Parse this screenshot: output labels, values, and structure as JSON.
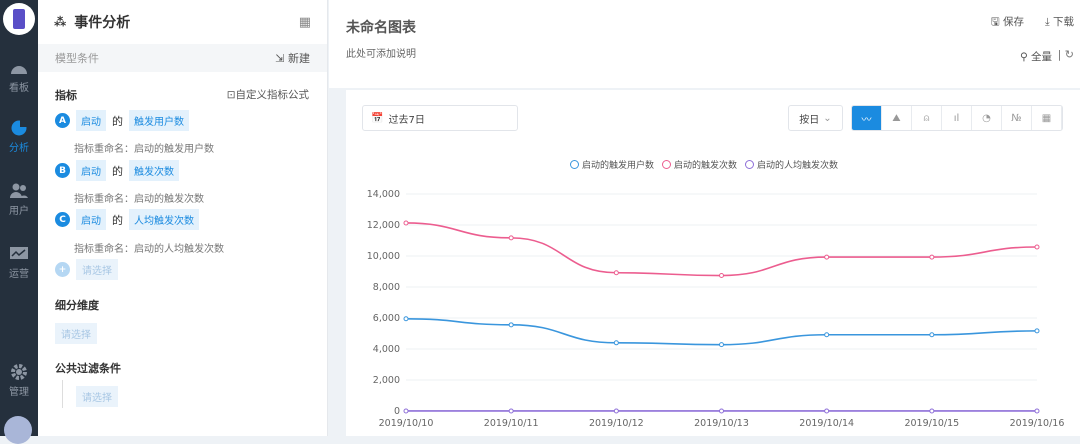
{
  "nav": {
    "items": [
      {
        "label": "看板"
      },
      {
        "label": "分析"
      },
      {
        "label": "用户"
      },
      {
        "label": "运营"
      },
      {
        "label": "管理"
      }
    ]
  },
  "panel": {
    "title": "事件分析",
    "model_label": "模型条件",
    "new_label": "新建",
    "metrics_heading": "指标",
    "custom_formula": "自定义指标公式",
    "metrics": [
      {
        "letter": "A",
        "event": "启动",
        "of": "的",
        "measure": "触发用户数",
        "rename": "指标重命名：启动的触发用户数"
      },
      {
        "letter": "B",
        "event": "启动",
        "of": "的",
        "measure": "触发次数",
        "rename": "指标重命名：启动的触发次数"
      },
      {
        "letter": "C",
        "event": "启动",
        "of": "的",
        "measure": "人均触发次数",
        "rename": "指标重命名：启动的人均触发次数"
      }
    ],
    "add_placeholder": "请选择",
    "breakdown_heading": "细分维度",
    "breakdown_placeholder": "请选择",
    "filter_heading": "公共过滤条件",
    "filter_placeholder": "请选择"
  },
  "header": {
    "title": "未命名图表",
    "description": "此处可添加说明",
    "save": "保存",
    "download": "下载",
    "fullscreen": "全量"
  },
  "toolbar": {
    "date_range": "过去7日",
    "granularity": "按日",
    "chart_types": [
      "line",
      "area",
      "funnel",
      "bar",
      "pie",
      "number",
      "table"
    ]
  },
  "colors": {
    "accent": "#1b8be0",
    "users": "#3a96dd",
    "count": "#ec5d8f",
    "avg": "#8e6fd8"
  },
  "chart_data": {
    "type": "line",
    "x": [
      "2019/10/10",
      "2019/10/11",
      "2019/10/12",
      "2019/10/13",
      "2019/10/14",
      "2019/10/15",
      "2019/10/16"
    ],
    "series": [
      {
        "name": "启动的触发用户数",
        "values": [
          5950,
          5560,
          4400,
          4280,
          4920,
          4920,
          5170
        ]
      },
      {
        "name": "启动的触发次数",
        "values": [
          12130,
          11170,
          8920,
          8740,
          9930,
          9930,
          10580
        ]
      },
      {
        "name": "启动的人均触发次数",
        "values": [
          2,
          2,
          2,
          2,
          2,
          2,
          2
        ]
      }
    ],
    "yticks": [
      "0",
      "2,000",
      "4,000",
      "6,000",
      "8,000",
      "10,000",
      "12,000",
      "14,000"
    ],
    "ylim": [
      0,
      14000
    ],
    "grid": true,
    "legend": "top-center"
  }
}
